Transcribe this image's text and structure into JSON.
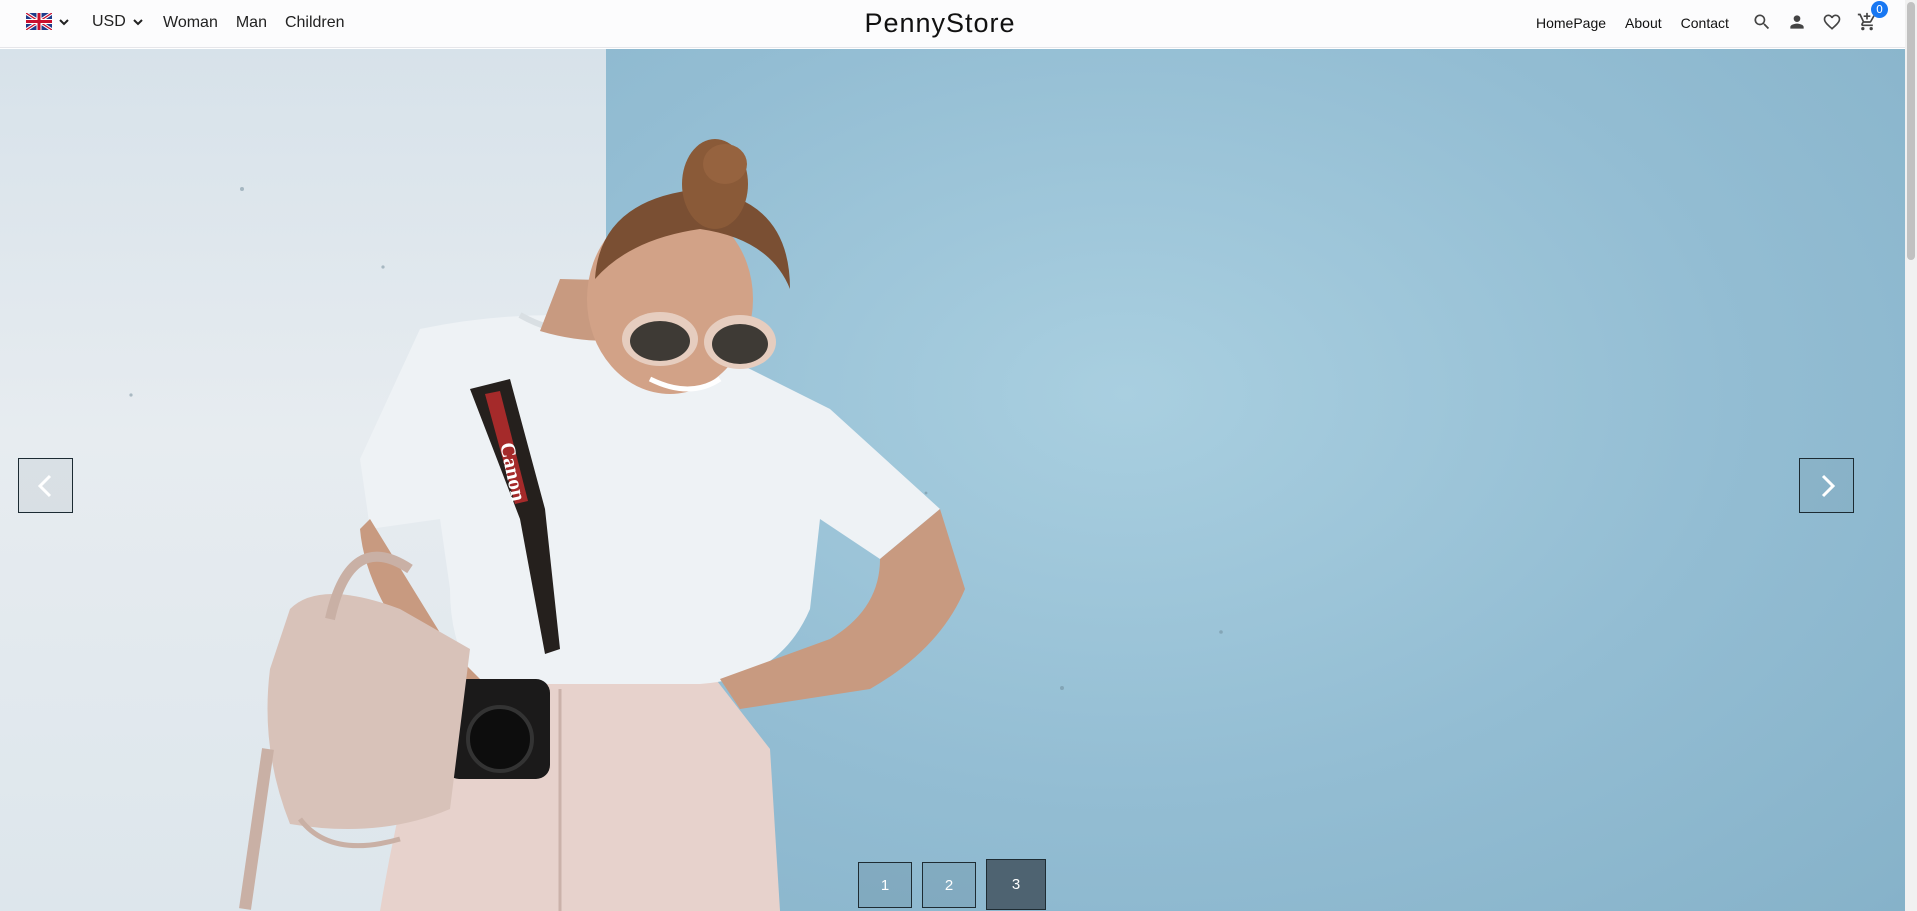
{
  "header": {
    "language": {
      "flag_icon": "uk-flag-icon",
      "dropdown_icon": "chevron-down-icon"
    },
    "currency": {
      "selected": "USD",
      "dropdown_icon": "chevron-down-icon"
    },
    "categories": [
      "Woman",
      "Man",
      "Children"
    ],
    "logo": "PennyStore",
    "nav": [
      "HomePage",
      "About",
      "Contact"
    ],
    "icons": [
      "search-icon",
      "user-icon",
      "heart-icon",
      "cart-icon"
    ],
    "cart_count": "0"
  },
  "hero": {
    "prev_icon": "chevron-left-icon",
    "next_icon": "chevron-right-icon",
    "pages": [
      "1",
      "2",
      "3"
    ],
    "active_page": "3",
    "strap_brand": "Canon",
    "colors": {
      "wall_left": "#e2e9ee",
      "wall_blue": "#93bdd3",
      "pager_active": "#4e6371"
    }
  }
}
